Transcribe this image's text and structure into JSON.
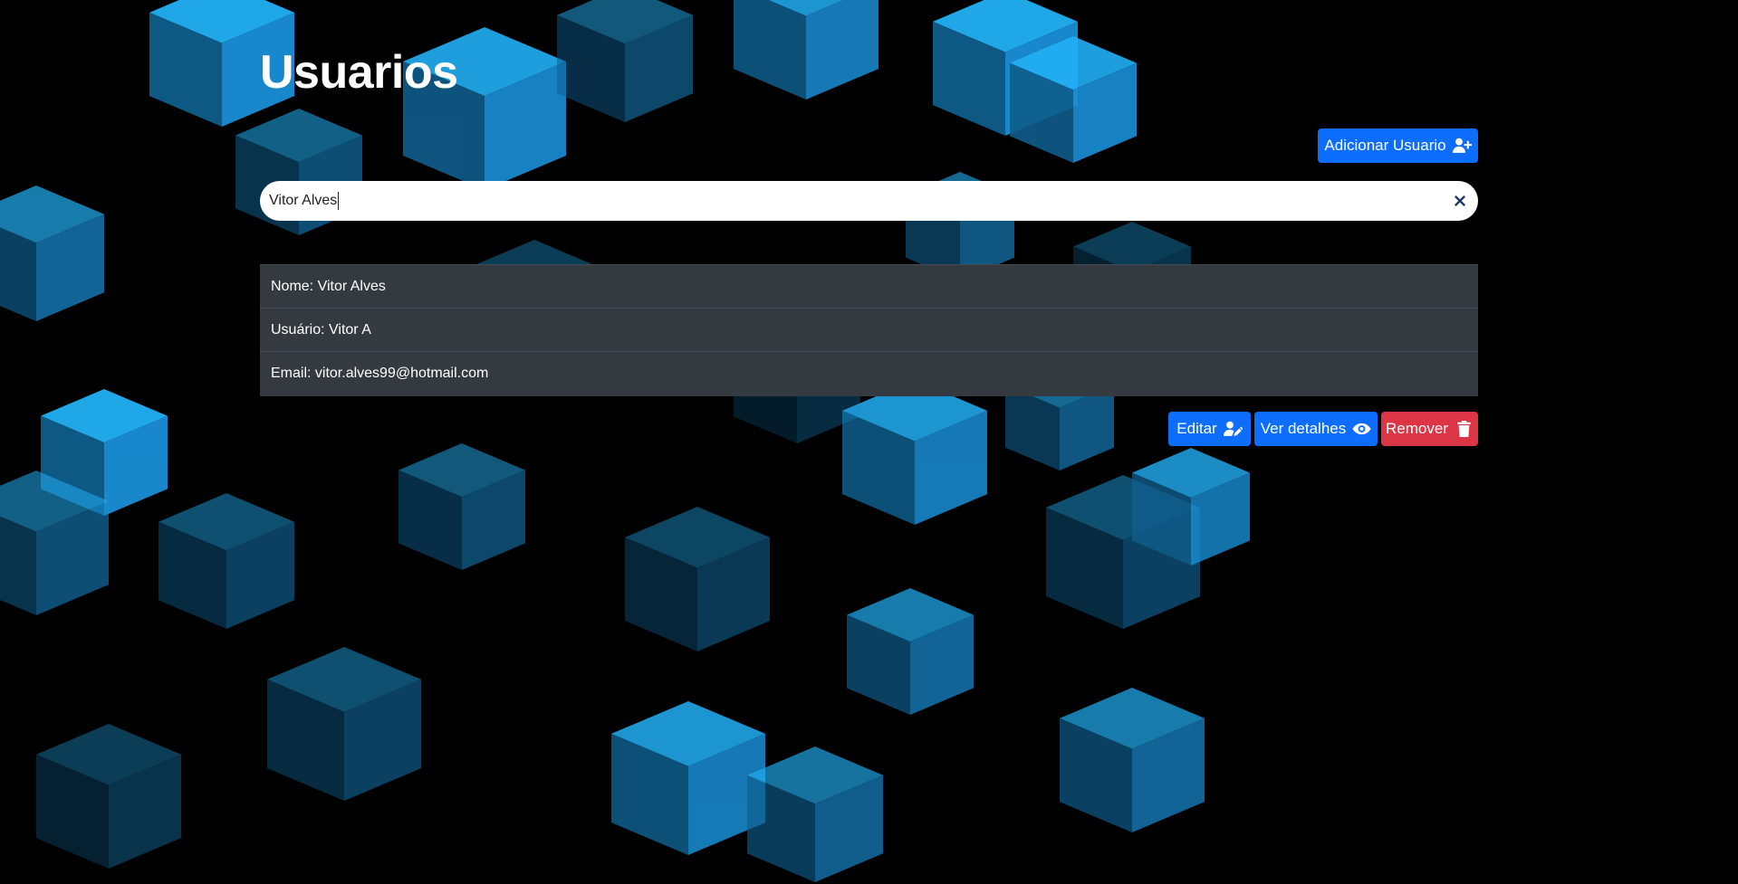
{
  "page": {
    "title": "Usuarios"
  },
  "toolbar": {
    "add_user_label": "Adicionar Usuario",
    "add_user_icon": "user-plus-icon"
  },
  "search": {
    "value": "Vitor Alves",
    "clear_icon": "close-icon"
  },
  "result": {
    "fields": [
      "Nome: Vitor Alves",
      "Usuário: Vitor A",
      "Email: vitor.alves99@hotmail.com"
    ]
  },
  "actions": {
    "edit_label": "Editar",
    "edit_icon": "user-edit-icon",
    "details_label": "Ver detalhes",
    "details_icon": "eye-icon",
    "remove_label": "Remover",
    "remove_icon": "trash-icon"
  },
  "colors": {
    "primary": "#0d6efd",
    "danger": "#dc3545",
    "panel": "#343a40",
    "background": "#000000"
  }
}
